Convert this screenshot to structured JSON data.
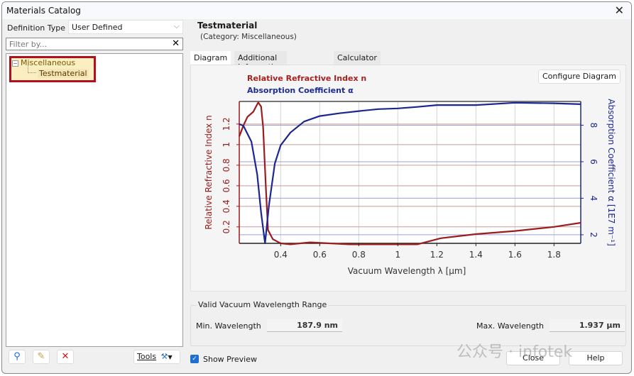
{
  "window": {
    "title": "Materials Catalog"
  },
  "left_panel": {
    "definition_type_label": "Definition Type",
    "definition_type_value": "User Defined",
    "filter_placeholder": "Filter by...",
    "tree": [
      {
        "label": "Miscellaneous",
        "expanded": true,
        "children": [
          {
            "label": "Testmaterial",
            "selected": true
          }
        ]
      }
    ],
    "tools_label": "Tools",
    "icons": [
      "search-icon",
      "edit-pencil-icon",
      "delete-x-icon"
    ]
  },
  "material": {
    "name": "Testmaterial",
    "category": "(Category: Miscellaneous)"
  },
  "tabs": [
    {
      "label": "Diagram",
      "active": true
    },
    {
      "label": "Additional Information",
      "active": false
    },
    {
      "label": "Calculator",
      "active": false
    }
  ],
  "configure_button": "Configure Diagram",
  "colors": {
    "n": "#9b1c1c",
    "alpha": "#1c2690",
    "grid_n": "#c99a9a",
    "grid_a": "#9aa0d6"
  },
  "chart_data": {
    "type": "line",
    "title": "",
    "xlabel": "Vacuum Wavelength λ [μm]",
    "ylabel": "Relative Refractive Index n",
    "y2label": "Absorption Coefficient α [1E7 m⁻¹]",
    "xlim": [
      0.1879,
      1.937
    ],
    "ylim": [
      0.04,
      1.42
    ],
    "y2lim": [
      1.53,
      9.3
    ],
    "xticks": [
      0.4,
      0.6,
      0.8,
      1,
      1.2,
      1.4,
      1.6,
      1.8
    ],
    "xtick_labels": [
      "0.4",
      "0.6",
      "0.8",
      "1",
      "1.2",
      "1.4",
      "1.6",
      "1.8"
    ],
    "yticks": [
      0.2,
      0.4,
      0.6,
      0.8,
      1,
      1.2
    ],
    "ytick_labels": [
      "0.2",
      "0.4",
      "0.6",
      "0.8",
      "1",
      "1.2"
    ],
    "y2ticks": [
      2,
      4,
      6,
      8
    ],
    "y2tick_labels": [
      "2",
      "4",
      "6",
      "8"
    ],
    "grid": true,
    "legend": "top-left",
    "series": [
      {
        "name": "Relative Refractive Index n",
        "axis": "left",
        "x": [
          0.188,
          0.21,
          0.23,
          0.26,
          0.285,
          0.3,
          0.31,
          0.325,
          0.335,
          0.36,
          0.4,
          0.45,
          0.55,
          0.65,
          0.75,
          1.1,
          1.22,
          1.4,
          1.6,
          1.8,
          1.937
        ],
        "y": [
          1.08,
          1.19,
          1.27,
          1.32,
          1.41,
          1.37,
          1.17,
          0.55,
          0.17,
          0.08,
          0.04,
          0.03,
          0.05,
          0.04,
          0.03,
          0.03,
          0.09,
          0.13,
          0.16,
          0.2,
          0.24
        ]
      },
      {
        "name": "Absorption Coefficient α",
        "axis": "right",
        "x": [
          0.188,
          0.21,
          0.25,
          0.28,
          0.3,
          0.32,
          0.34,
          0.37,
          0.4,
          0.45,
          0.52,
          0.6,
          0.7,
          0.8,
          0.9,
          1.0,
          1.1,
          1.2,
          1.4,
          1.6,
          1.8,
          1.937
        ],
        "y": [
          8.07,
          7.95,
          7.1,
          5.3,
          3.2,
          1.53,
          3.6,
          5.9,
          6.9,
          7.6,
          8.2,
          8.5,
          8.65,
          8.77,
          8.88,
          8.92,
          9.0,
          9.1,
          9.1,
          9.23,
          9.2,
          9.15
        ]
      }
    ]
  },
  "range": {
    "title": "Valid Vacuum Wavelength Range",
    "min_label": "Min. Wavelength",
    "min_value": "187.9 nm",
    "max_label": "Max. Wavelength",
    "max_value": "1.937 μm"
  },
  "show_preview": {
    "label": "Show Preview",
    "checked": true
  },
  "buttons": {
    "close": "Close",
    "help": "Help"
  },
  "watermark": "公众号 · infotek"
}
